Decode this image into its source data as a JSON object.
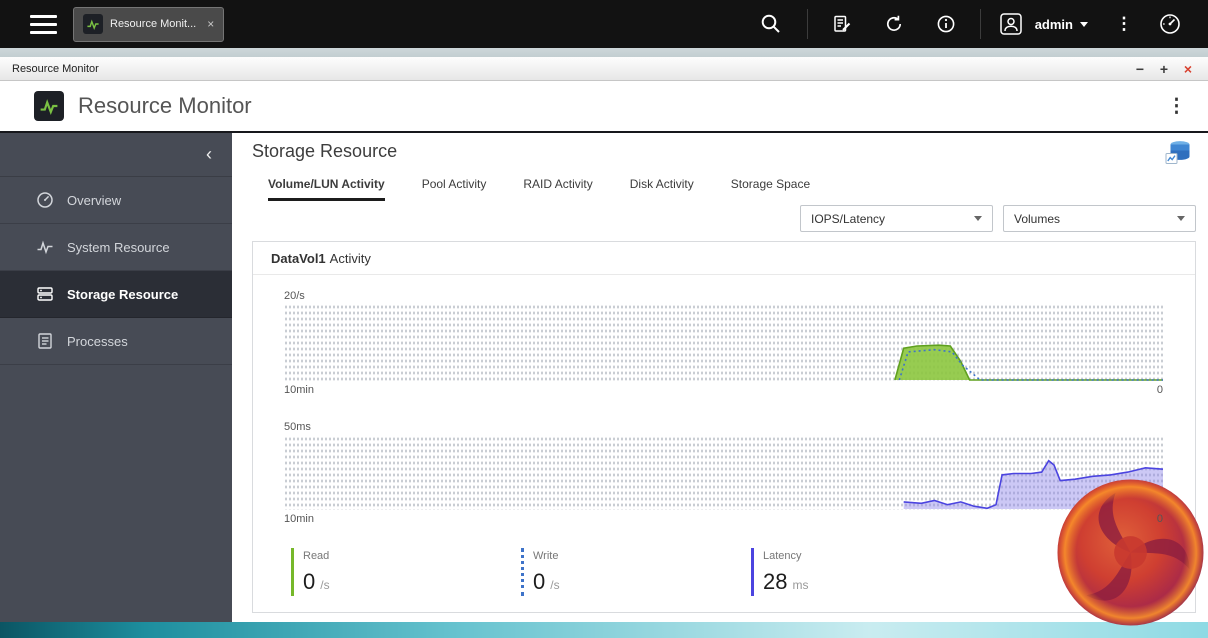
{
  "topbar": {
    "tab_label": "Resource Monit...",
    "tab_close": "×",
    "user_name": "admin",
    "more_glyph": "⋮"
  },
  "window": {
    "title": "Resource Monitor",
    "minimize": "−",
    "maximize": "+",
    "close": "×"
  },
  "app_header": {
    "title": "Resource Monitor",
    "menu_glyph": "⋮"
  },
  "sidebar": {
    "collapse_glyph": "‹",
    "items": [
      {
        "label": "Overview"
      },
      {
        "label": "System Resource"
      },
      {
        "label": "Storage Resource"
      },
      {
        "label": "Processes"
      }
    ]
  },
  "main": {
    "heading": "Storage Resource",
    "tabs": [
      {
        "label": "Volume/LUN Activity"
      },
      {
        "label": "Pool Activity"
      },
      {
        "label": "RAID Activity"
      },
      {
        "label": "Disk Activity"
      },
      {
        "label": "Storage Space"
      }
    ],
    "metric_dropdown": "IOPS/Latency",
    "scope_dropdown": "Volumes",
    "card_title": "DataVol1",
    "card_title_suffix": "Activity"
  },
  "legend": [
    {
      "label": "Read",
      "value": "0",
      "unit": "/s"
    },
    {
      "label": "Write",
      "value": "0",
      "unit": "/s"
    },
    {
      "label": "Latency",
      "value": "28",
      "unit": "ms"
    }
  ],
  "chart_data": [
    {
      "type": "area",
      "name": "DataVol1 IOPS",
      "y_top_label": "20/s",
      "x_left_label": "10min",
      "x_right_label": "0",
      "ylim": [
        0,
        20
      ],
      "x_minutes_ago": [
        10,
        0
      ],
      "grid": "dotted",
      "series": [
        {
          "name": "Read",
          "style": "solid",
          "color": "#5fa01e",
          "fill": "#8cc63e",
          "fill_opacity": 0.9,
          "points": [
            [
              3.05,
              0
            ],
            [
              2.95,
              8.6
            ],
            [
              2.8,
              9.2
            ],
            [
              2.55,
              9.4
            ],
            [
              2.42,
              9.2
            ],
            [
              2.3,
              5
            ],
            [
              2.2,
              0
            ],
            [
              1.8,
              0
            ],
            [
              1.2,
              0
            ],
            [
              0.6,
              0
            ],
            [
              0,
              0
            ]
          ]
        },
        {
          "name": "Write",
          "style": "dotted",
          "color": "#3e73c9",
          "points": [
            [
              3.0,
              0
            ],
            [
              2.9,
              7.6
            ],
            [
              2.6,
              8.2
            ],
            [
              2.4,
              7.6
            ],
            [
              2.28,
              4
            ],
            [
              2.08,
              0
            ],
            [
              1.5,
              0
            ],
            [
              0.8,
              0
            ],
            [
              0,
              0
            ]
          ]
        }
      ]
    },
    {
      "type": "area",
      "name": "DataVol1 Latency",
      "y_top_label": "50ms",
      "x_left_label": "10min",
      "x_right_label": "0",
      "ylim": [
        0,
        50
      ],
      "x_minutes_ago": [
        10,
        0
      ],
      "grid": "dotted",
      "series": [
        {
          "name": "Latency",
          "style": "solid",
          "color": "#4b44e0",
          "fill": "#8d85e8",
          "fill_opacity": 0.45,
          "points": [
            [
              2.95,
              5
            ],
            [
              2.75,
              4
            ],
            [
              2.6,
              6
            ],
            [
              2.45,
              3
            ],
            [
              2.3,
              5
            ],
            [
              2.15,
              2
            ],
            [
              2.0,
              0.5
            ],
            [
              1.9,
              3
            ],
            [
              1.83,
              24
            ],
            [
              1.7,
              25
            ],
            [
              1.5,
              25
            ],
            [
              1.38,
              26
            ],
            [
              1.3,
              34
            ],
            [
              1.24,
              31
            ],
            [
              1.17,
              20
            ],
            [
              1.0,
              21
            ],
            [
              0.8,
              23
            ],
            [
              0.6,
              24
            ],
            [
              0.4,
              26
            ],
            [
              0.2,
              29
            ],
            [
              0,
              28
            ]
          ]
        }
      ]
    }
  ],
  "colors": {
    "read_green": "#76b82a",
    "write_blue": "#3e73c9",
    "latency_blue": "#4b44e0",
    "close_red": "#d8412f",
    "sidebar_bg": "#474b55",
    "sidebar_active_bg": "#2b2e36",
    "taskbar_teal": "#2da8ba"
  }
}
